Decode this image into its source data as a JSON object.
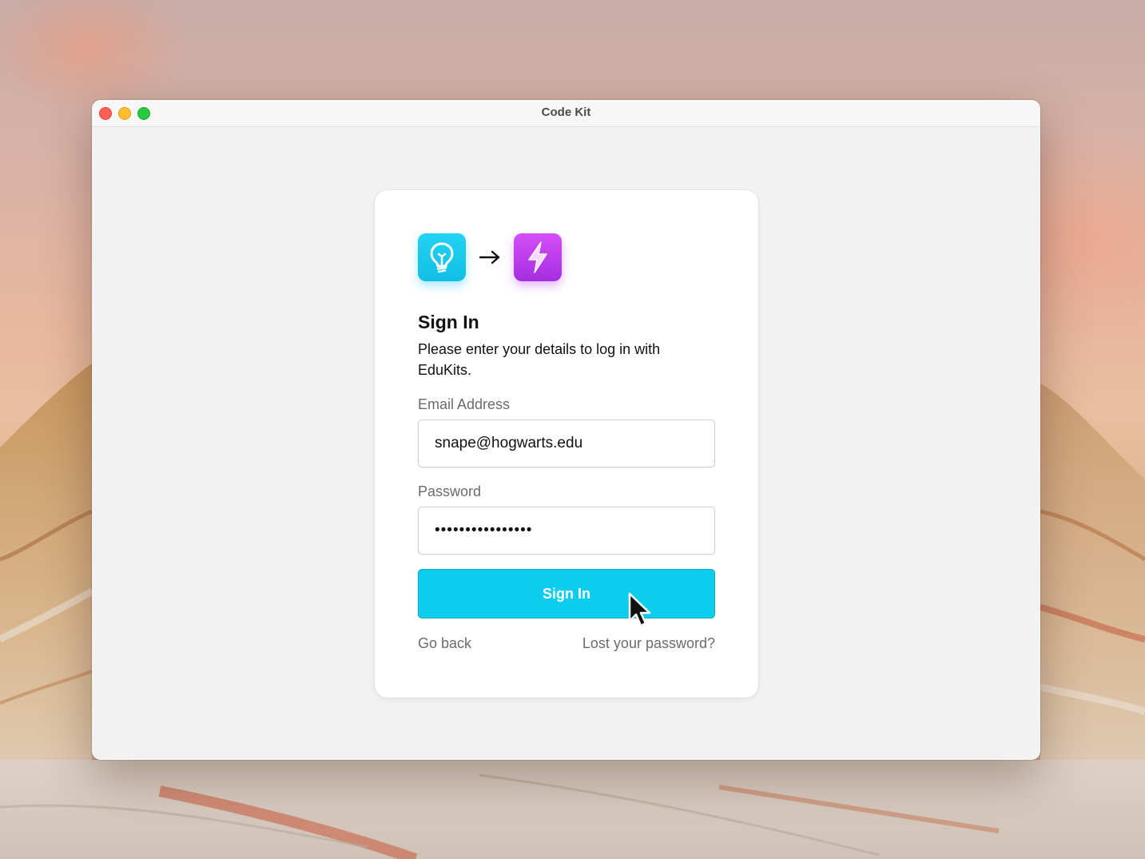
{
  "window": {
    "title": "Code Kit"
  },
  "logo_row": {
    "from_icon": "lightbulb-icon",
    "arrow_icon": "arrow-right-icon",
    "to_icon": "lightning-bolt-icon"
  },
  "signin": {
    "heading": "Sign In",
    "subtitle": "Please enter your details to log in with EduKits.",
    "email_label": "Email Address",
    "email_value": "snape@hogwarts.edu",
    "password_label": "Password",
    "password_value": "••••••••••••••••",
    "submit_label": "Sign In",
    "go_back_label": "Go back",
    "lost_password_label": "Lost your password?"
  },
  "colors": {
    "accent": "#0ccdee",
    "bulb_icon_bg": "#10bfe4",
    "bolt_icon_bg": "#b036e6",
    "traffic_close": "#fe5f57",
    "traffic_minimize": "#febc2e",
    "traffic_zoom": "#28c840"
  }
}
